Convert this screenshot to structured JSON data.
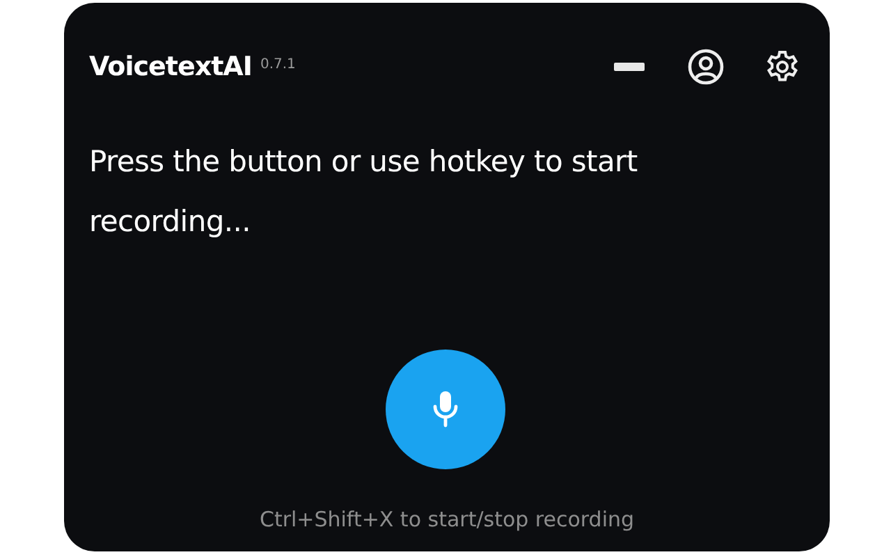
{
  "app": {
    "name": "VoicetextAI",
    "version": "0.7.1"
  },
  "message": "Press the button or use hotkey to start recording...",
  "record_button": {
    "recording": false
  },
  "hint": "Ctrl+Shift+X to start/stop recording"
}
